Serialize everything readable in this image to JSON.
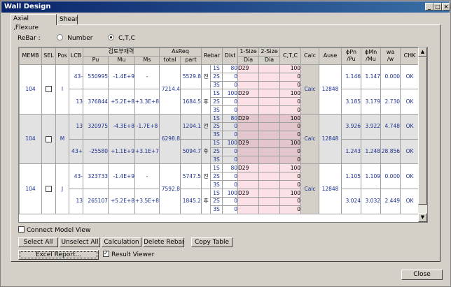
{
  "window": {
    "title": "Wall Design"
  },
  "tabs": [
    {
      "label": "Axial ,Flexure"
    },
    {
      "label": "Shear"
    }
  ],
  "rebar": {
    "label": "ReBar :",
    "option_number": "Number",
    "option_ctc": "C,T,C",
    "selected": "C,T,C"
  },
  "headers": {
    "memb": "MEMB",
    "sel": "SEL",
    "pos": "Pos",
    "lcb": "LCB",
    "review_force": "검토부재력",
    "pu": "Pu",
    "mu": "Mu",
    "ms": "Ms",
    "asreq": "AsReq",
    "total": "total",
    "part": "part",
    "rebar": "Rebar",
    "dist": "Dist",
    "size1": "1-Size",
    "size2": "2-Size",
    "dia1": "Dia",
    "dia2": "Dia",
    "ctc": "C,T,C",
    "calc": "Calc",
    "ause": "Ause",
    "phipn": "ϕPn",
    "phipn2": "/Pu",
    "phimn": "ϕMn",
    "phimn2": "/Mu",
    "wa": "wa",
    "wa2": "/w",
    "chk": "CHK"
  },
  "groups": [
    {
      "memb": "104",
      "pos": "I",
      "total": "7214.4",
      "ause": "12848",
      "calc": "Calc",
      "lcbs": [
        {
          "lcb": "43-",
          "pu": "550995",
          "mu": "-1.4E+9",
          "ms": "-",
          "part": "5529.8",
          "side": "전",
          "phipn": "1.146",
          "phimn": "1.147",
          "wa": "0.000",
          "chk": "OK",
          "rows": [
            {
              "layer": "1S",
              "dist": "80",
              "dia": "D29",
              "ctc": "100"
            },
            {
              "layer": "2S",
              "dist": "0",
              "dia": "",
              "ctc": "0"
            },
            {
              "layer": "3S",
              "dist": "0",
              "dia": "",
              "ctc": "0"
            }
          ]
        },
        {
          "lcb": "13",
          "pu": "376844",
          "mu": "+5.2E+8",
          "ms": "+3.3E+8",
          "part": "1684.5",
          "side": "후",
          "phipn": "3.185",
          "phimn": "3.179",
          "wa": "2.730",
          "chk": "OK",
          "rows": [
            {
              "layer": "1S",
              "dist": "100",
              "dia": "D29",
              "ctc": "100"
            },
            {
              "layer": "2S",
              "dist": "0",
              "dia": "",
              "ctc": "0"
            },
            {
              "layer": "3S",
              "dist": "0",
              "dia": "",
              "ctc": "0"
            }
          ]
        }
      ]
    },
    {
      "memb": "104",
      "pos": "M",
      "total": "6298.8",
      "ause": "12848",
      "calc": "Calc",
      "lcbs": [
        {
          "lcb": "13",
          "pu": "320975",
          "mu": "-4.3E+8",
          "ms": "-1.7E+8",
          "part": "1204.1",
          "side": "전",
          "phipn": "3.926",
          "phimn": "3.922",
          "wa": "4.748",
          "chk": "OK",
          "rows": [
            {
              "layer": "1S",
              "dist": "80",
              "dia": "D29",
              "ctc": "100"
            },
            {
              "layer": "2S",
              "dist": "0",
              "dia": "",
              "ctc": "0"
            },
            {
              "layer": "3S",
              "dist": "0",
              "dia": "",
              "ctc": "0"
            }
          ]
        },
        {
          "lcb": "43+",
          "pu": "-25580",
          "mu": "+1.1E+9",
          "ms": "+3.1E+7",
          "part": "5094.7",
          "side": "후",
          "phipn": "1.243",
          "phimn": "1.248",
          "wa": "28.856",
          "chk": "OK",
          "rows": [
            {
              "layer": "1S",
              "dist": "100",
              "dia": "D29",
              "ctc": "100"
            },
            {
              "layer": "2S",
              "dist": "0",
              "dia": "",
              "ctc": "0"
            },
            {
              "layer": "3S",
              "dist": "0",
              "dia": "",
              "ctc": "0"
            }
          ]
        }
      ]
    },
    {
      "memb": "104",
      "pos": "J",
      "total": "7592.8",
      "ause": "12848",
      "calc": "Calc",
      "lcbs": [
        {
          "lcb": "43-",
          "pu": "323733",
          "mu": "-1.4E+9",
          "ms": "-",
          "part": "5747.5",
          "side": "전",
          "phipn": "1.105",
          "phimn": "1.109",
          "wa": "0.000",
          "chk": "OK",
          "rows": [
            {
              "layer": "1S",
              "dist": "80",
              "dia": "D29",
              "ctc": "100"
            },
            {
              "layer": "2S",
              "dist": "0",
              "dia": "",
              "ctc": "0"
            },
            {
              "layer": "3S",
              "dist": "0",
              "dia": "",
              "ctc": "0"
            }
          ]
        },
        {
          "lcb": "13",
          "pu": "265107",
          "mu": "+5.2E+8",
          "ms": "+3.5E+8",
          "part": "1845.2",
          "side": "후",
          "phipn": "3.024",
          "phimn": "3.032",
          "wa": "2.449",
          "chk": "OK",
          "rows": [
            {
              "layer": "1S",
              "dist": "100",
              "dia": "D29",
              "ctc": "100"
            },
            {
              "layer": "2S",
              "dist": "0",
              "dia": "",
              "ctc": "0"
            },
            {
              "layer": "3S",
              "dist": "0",
              "dia": "",
              "ctc": "0"
            }
          ]
        }
      ]
    }
  ],
  "options": {
    "connect_model_view": "Connect Model View",
    "result_viewer": "Result Viewer"
  },
  "buttons": {
    "select_all": "Select All",
    "unselect_all": "Unselect All",
    "calculation": "Calculation",
    "delete_rebar": "Delete Rebar",
    "copy_table": "Copy Table",
    "excel_report": "Excel Report...",
    "close": "Close"
  }
}
